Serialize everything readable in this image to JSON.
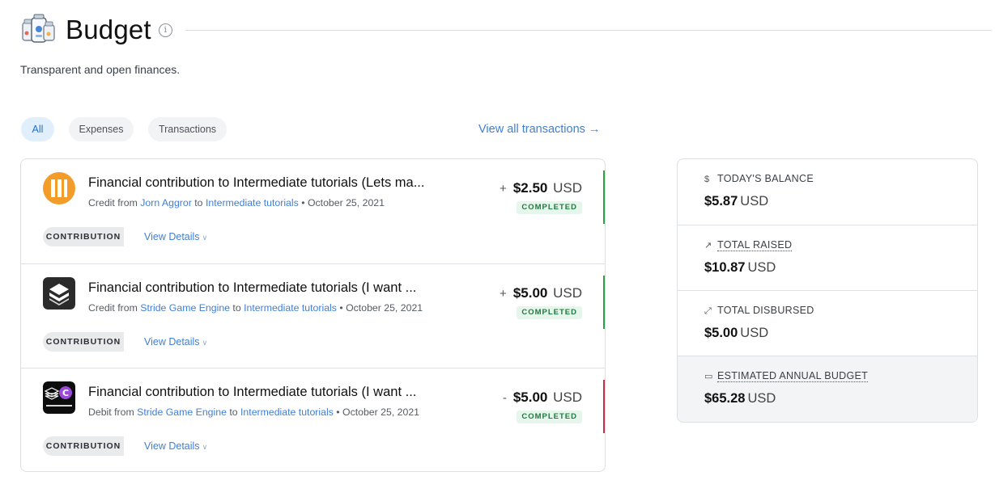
{
  "header": {
    "title": "Budget",
    "info_glyph": "i",
    "subtitle": "Transparent and open finances."
  },
  "filters": {
    "tabs": [
      {
        "label": "All",
        "active": true
      },
      {
        "label": "Expenses",
        "active": false
      },
      {
        "label": "Transactions",
        "active": false
      }
    ],
    "view_all_label": "View all transactions →"
  },
  "transactions": [
    {
      "title": "Financial contribution to Intermediate tutorials (Lets ma...",
      "kind": "Credit",
      "from_word": "from",
      "from": "Jorn Aggror",
      "to_word": "to",
      "to": "Intermediate tutorials",
      "separator": "•",
      "date": "October 25, 2021",
      "sign": "+",
      "amount": "$2.50",
      "currency": "USD",
      "status": "COMPLETED",
      "tag": "CONTRIBUTION",
      "details_label": "View Details",
      "accent_color": "#2e9e48",
      "avatar": "orange-circle-logo"
    },
    {
      "title": "Financial contribution to Intermediate tutorials (I want ...",
      "kind": "Credit",
      "from_word": "from",
      "from": "Stride Game Engine",
      "to_word": "to",
      "to": "Intermediate tutorials",
      "separator": "•",
      "date": "October 25, 2021",
      "sign": "+",
      "amount": "$5.00",
      "currency": "USD",
      "status": "COMPLETED",
      "tag": "CONTRIBUTION",
      "details_label": "View Details",
      "accent_color": "#2e9e48",
      "avatar": "stride-layers-logo"
    },
    {
      "title": "Financial contribution to Intermediate tutorials (I want ...",
      "kind": "Debit",
      "from_word": "from",
      "from": "Stride Game Engine",
      "to_word": "to",
      "to": "Intermediate tutorials",
      "separator": "•",
      "date": "October 25, 2021",
      "sign": "-",
      "amount": "$5.00",
      "currency": "USD",
      "status": "COMPLETED",
      "tag": "CONTRIBUTION",
      "details_label": "View Details",
      "accent_color": "#c8304a",
      "avatar": "intermediate-csharp-logo"
    }
  ],
  "stats": [
    {
      "icon": "dollar-icon",
      "glyph": "$",
      "label": "TODAY'S BALANCE",
      "amount": "$5.87",
      "currency": "USD"
    },
    {
      "icon": "trend-icon",
      "glyph": "↗",
      "label": "TOTAL RAISED",
      "amount": "$10.87",
      "currency": "USD"
    },
    {
      "icon": "expand-icon",
      "glyph": "⤢",
      "label": "TOTAL DISBURSED",
      "amount": "$5.00",
      "currency": "USD"
    },
    {
      "icon": "calendar-icon",
      "glyph": "▭",
      "label": "ESTIMATED ANNUAL BUDGET",
      "amount": "$65.28",
      "currency": "USD"
    }
  ],
  "colors": {
    "link": "#3f7fd6",
    "credit_accent": "#2e9e48",
    "debit_accent": "#c8304a",
    "status_bg": "#e7f6ec",
    "status_text": "#1f7a3e"
  }
}
